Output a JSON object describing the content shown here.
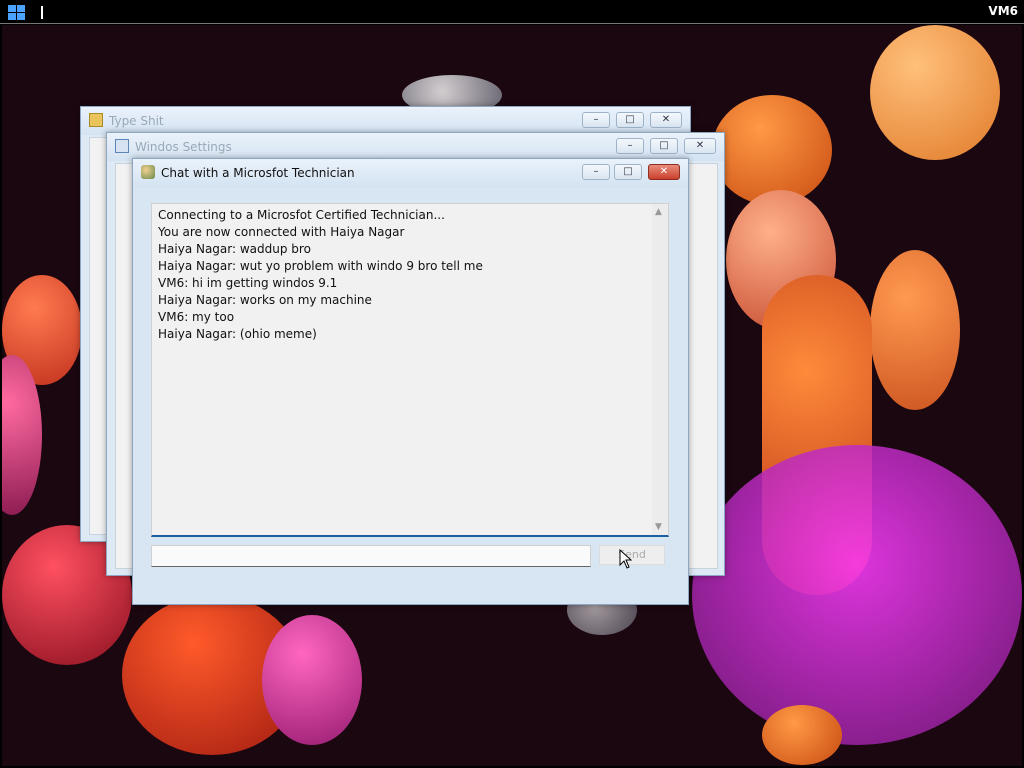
{
  "topbar": {
    "vm_label": "VM6"
  },
  "windows": {
    "back": {
      "title": "Type Shit"
    },
    "middle": {
      "title": "Windos Settings"
    },
    "chat": {
      "title": "Chat with a Microsfot Technician",
      "messages": [
        "Connecting to a Microsfot Certified Technician...",
        "You are now connected with Haiya Nagar",
        "Haiya Nagar: waddup bro",
        "Haiya Nagar: wut yo problem with windo 9 bro tell me",
        "VM6: hi im getting windos 9.1",
        "Haiya Nagar: works on my machine",
        "VM6: my too",
        "Haiya Nagar: (ohio meme)"
      ],
      "input_value": "",
      "send_label": "Send"
    }
  },
  "controls": {
    "minimize": "–",
    "maximize": "□",
    "close": "✕"
  },
  "colors": {
    "accent": "#1b5fa0",
    "close": "#c9402c"
  }
}
